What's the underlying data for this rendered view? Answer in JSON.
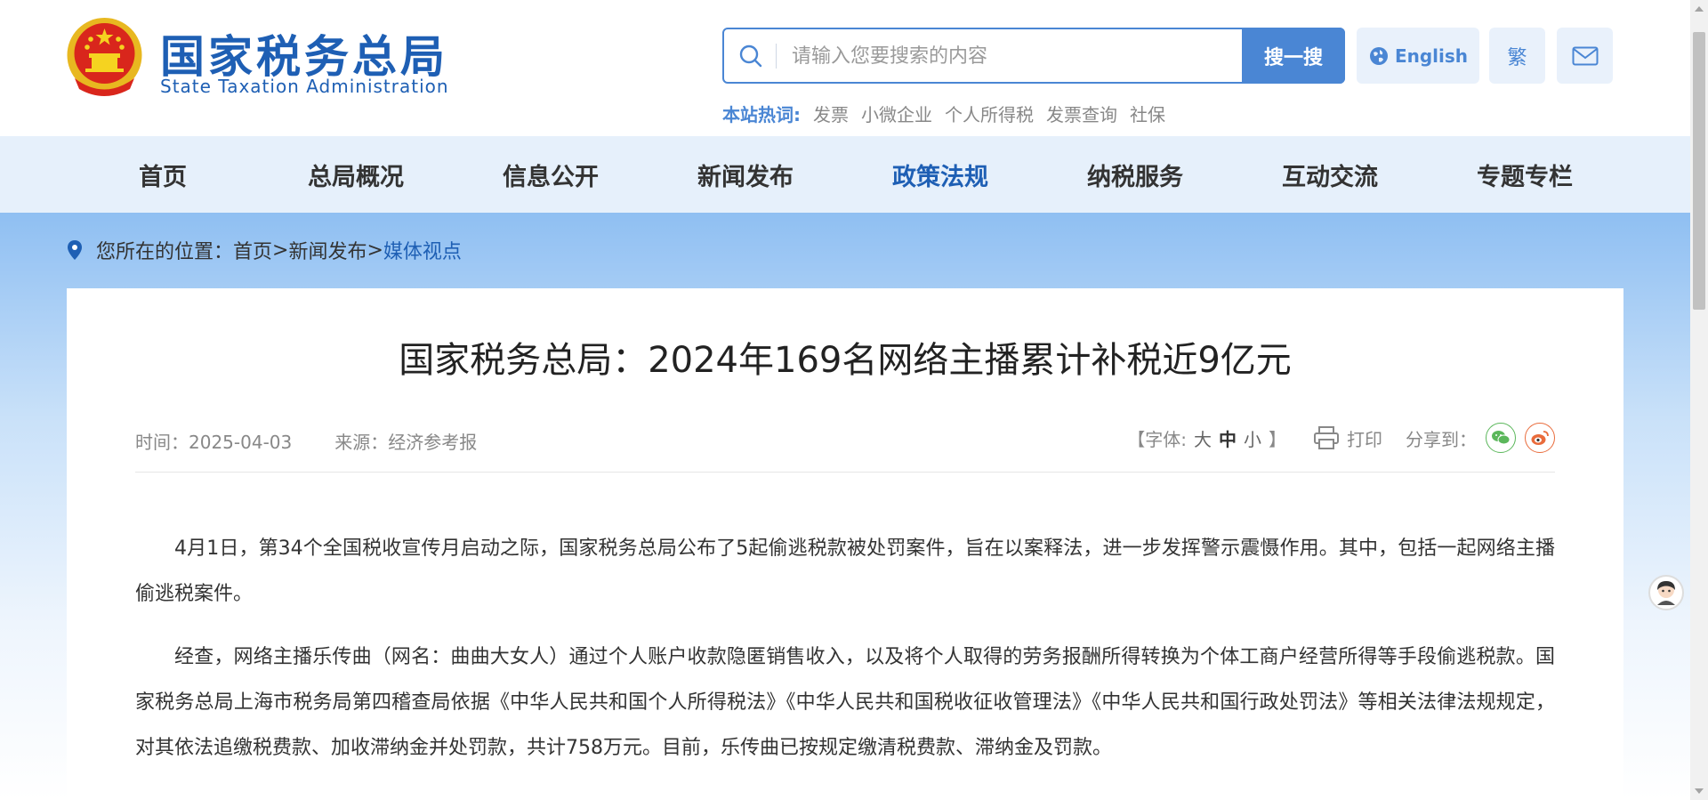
{
  "header": {
    "site_title": "国家税务总局",
    "site_subtitle": "State Taxation Administration",
    "search": {
      "placeholder": "请输入您要搜索的内容",
      "button_label": "搜一搜"
    },
    "english_label": "English",
    "traditional_label": "繁",
    "hotwords_label": "本站热词:",
    "hotwords": [
      "发票",
      "小微企业",
      "个人所得税",
      "发票查询",
      "社保"
    ]
  },
  "nav": {
    "items": [
      {
        "label": "首页"
      },
      {
        "label": "总局概况"
      },
      {
        "label": "信息公开"
      },
      {
        "label": "新闻发布"
      },
      {
        "label": "政策法规"
      },
      {
        "label": "纳税服务"
      },
      {
        "label": "互动交流"
      },
      {
        "label": "专题专栏"
      }
    ],
    "active_index": 4
  },
  "breadcrumb": {
    "prefix": "您所在的位置：",
    "items": [
      "首页",
      "新闻发布",
      "媒体视点"
    ],
    "separator": ">"
  },
  "article": {
    "title": "国家税务总局：2024年169名网络主播累计补税近9亿元",
    "time_label": "时间：",
    "time": "2025-04-03",
    "source_label": "来源：",
    "source": "经济参考报",
    "font_size_prefix": "【字体:",
    "font_size_large": "大",
    "font_size_medium": "中",
    "font_size_small": "小",
    "font_size_suffix": "】",
    "print_label": "打印",
    "share_label": "分享到：",
    "paragraphs": [
      "4月1日，第34个全国税收宣传月启动之际，国家税务总局公布了5起偷逃税款被处罚案件，旨在以案释法，进一步发挥警示震慑作用。其中，包括一起网络主播偷逃税案件。",
      "经查，网络主播乐传曲（网名：曲曲大女人）通过个人账户收款隐匿销售收入，以及将个人取得的劳务报酬所得转换为个体工商户经营所得等手段偷逃税款。国家税务总局上海市税务局第四稽查局依据《中华人民共和国个人所得税法》《中华人民共和国税收征收管理法》《中华人民共和国行政处罚法》等相关法律法规规定，对其依法追缴税费款、加收滞纳金并处罚款，共计758万元。目前，乐传曲已按规定缴清税费款、滞纳金及罚款。"
    ]
  },
  "colors": {
    "brand_blue": "#1e5fb4",
    "search_blue": "#4a86d4",
    "nav_bg": "#e6f0fb",
    "wechat_green": "#5bb75b",
    "weibo_orange": "#e96c3c"
  }
}
